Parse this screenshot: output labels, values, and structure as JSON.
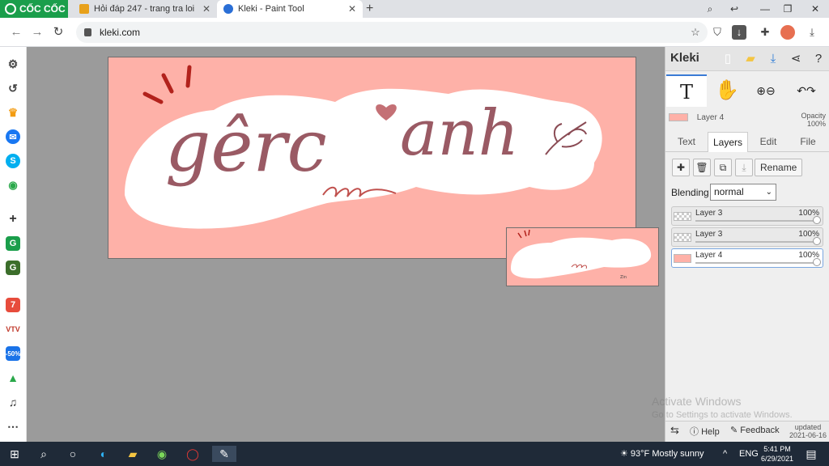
{
  "browser": {
    "brand": "CỐC CỐC",
    "tabs": [
      {
        "title": "Hỏi đáp 247 - trang tra loi",
        "close": "✕"
      },
      {
        "title": "Kleki - Paint Tool",
        "close": "✕"
      }
    ],
    "new_tab": "+",
    "url": "kleki.com"
  },
  "artwork": {
    "text_left": "gêrc",
    "text_right": "anh",
    "signature": "Zin"
  },
  "panel": {
    "logo": "Kleki",
    "current_layer": "Layer 4",
    "opacity_label": "Opacity",
    "opacity_value": "100%",
    "tabs": [
      "Text",
      "Layers",
      "Edit",
      "File"
    ],
    "rename": "Rename",
    "blending_label": "Blending",
    "blending_value": "normal",
    "layers": [
      {
        "name": "Layer 3",
        "opacity": "100%"
      },
      {
        "name": "Layer 3",
        "opacity": "100%"
      },
      {
        "name": "Layer 4",
        "opacity": "100%"
      }
    ],
    "footer": {
      "help": "Help",
      "feedback": "Feedback",
      "updated_label": "updated",
      "updated_date": "2021-06-16"
    }
  },
  "watermark": {
    "line1": "Activate Windows",
    "line2": "Go to Settings to activate Windows."
  },
  "taskbar": {
    "weather": "93°F  Mostly sunny",
    "lang": "ENG",
    "time": "5:41 PM",
    "date": "6/29/2021"
  },
  "colors": {
    "artwork_bg": "#feb1a8",
    "canvas_bg": "#9b9b9b",
    "brand_green": "#1a9e4b",
    "taskbar": "#1f2a38"
  }
}
